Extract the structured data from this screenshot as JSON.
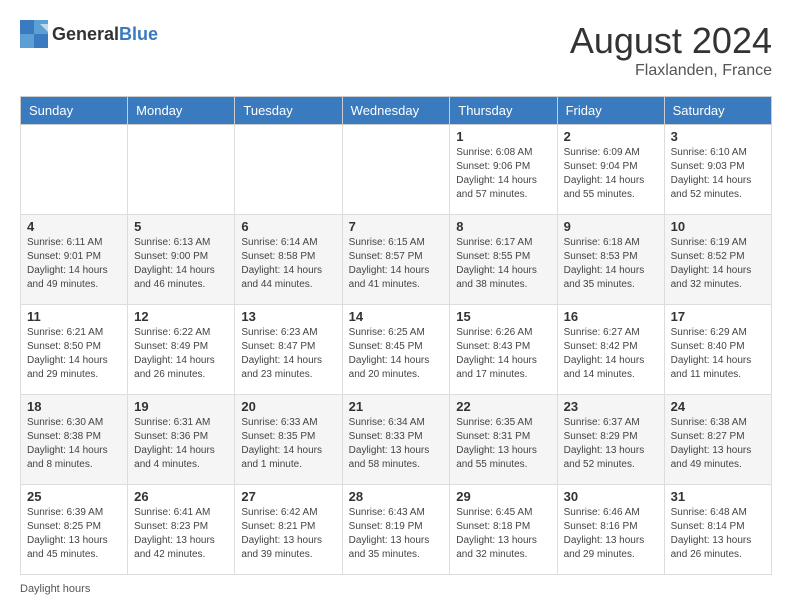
{
  "header": {
    "logo_general": "General",
    "logo_blue": "Blue",
    "month_year": "August 2024",
    "location": "Flaxlanden, France"
  },
  "weekdays": [
    "Sunday",
    "Monday",
    "Tuesday",
    "Wednesday",
    "Thursday",
    "Friday",
    "Saturday"
  ],
  "weeks": [
    [
      {
        "day": "",
        "info": ""
      },
      {
        "day": "",
        "info": ""
      },
      {
        "day": "",
        "info": ""
      },
      {
        "day": "",
        "info": ""
      },
      {
        "day": "1",
        "info": "Sunrise: 6:08 AM\nSunset: 9:06 PM\nDaylight: 14 hours and 57 minutes."
      },
      {
        "day": "2",
        "info": "Sunrise: 6:09 AM\nSunset: 9:04 PM\nDaylight: 14 hours and 55 minutes."
      },
      {
        "day": "3",
        "info": "Sunrise: 6:10 AM\nSunset: 9:03 PM\nDaylight: 14 hours and 52 minutes."
      }
    ],
    [
      {
        "day": "4",
        "info": "Sunrise: 6:11 AM\nSunset: 9:01 PM\nDaylight: 14 hours and 49 minutes."
      },
      {
        "day": "5",
        "info": "Sunrise: 6:13 AM\nSunset: 9:00 PM\nDaylight: 14 hours and 46 minutes."
      },
      {
        "day": "6",
        "info": "Sunrise: 6:14 AM\nSunset: 8:58 PM\nDaylight: 14 hours and 44 minutes."
      },
      {
        "day": "7",
        "info": "Sunrise: 6:15 AM\nSunset: 8:57 PM\nDaylight: 14 hours and 41 minutes."
      },
      {
        "day": "8",
        "info": "Sunrise: 6:17 AM\nSunset: 8:55 PM\nDaylight: 14 hours and 38 minutes."
      },
      {
        "day": "9",
        "info": "Sunrise: 6:18 AM\nSunset: 8:53 PM\nDaylight: 14 hours and 35 minutes."
      },
      {
        "day": "10",
        "info": "Sunrise: 6:19 AM\nSunset: 8:52 PM\nDaylight: 14 hours and 32 minutes."
      }
    ],
    [
      {
        "day": "11",
        "info": "Sunrise: 6:21 AM\nSunset: 8:50 PM\nDaylight: 14 hours and 29 minutes."
      },
      {
        "day": "12",
        "info": "Sunrise: 6:22 AM\nSunset: 8:49 PM\nDaylight: 14 hours and 26 minutes."
      },
      {
        "day": "13",
        "info": "Sunrise: 6:23 AM\nSunset: 8:47 PM\nDaylight: 14 hours and 23 minutes."
      },
      {
        "day": "14",
        "info": "Sunrise: 6:25 AM\nSunset: 8:45 PM\nDaylight: 14 hours and 20 minutes."
      },
      {
        "day": "15",
        "info": "Sunrise: 6:26 AM\nSunset: 8:43 PM\nDaylight: 14 hours and 17 minutes."
      },
      {
        "day": "16",
        "info": "Sunrise: 6:27 AM\nSunset: 8:42 PM\nDaylight: 14 hours and 14 minutes."
      },
      {
        "day": "17",
        "info": "Sunrise: 6:29 AM\nSunset: 8:40 PM\nDaylight: 14 hours and 11 minutes."
      }
    ],
    [
      {
        "day": "18",
        "info": "Sunrise: 6:30 AM\nSunset: 8:38 PM\nDaylight: 14 hours and 8 minutes."
      },
      {
        "day": "19",
        "info": "Sunrise: 6:31 AM\nSunset: 8:36 PM\nDaylight: 14 hours and 4 minutes."
      },
      {
        "day": "20",
        "info": "Sunrise: 6:33 AM\nSunset: 8:35 PM\nDaylight: 14 hours and 1 minute."
      },
      {
        "day": "21",
        "info": "Sunrise: 6:34 AM\nSunset: 8:33 PM\nDaylight: 13 hours and 58 minutes."
      },
      {
        "day": "22",
        "info": "Sunrise: 6:35 AM\nSunset: 8:31 PM\nDaylight: 13 hours and 55 minutes."
      },
      {
        "day": "23",
        "info": "Sunrise: 6:37 AM\nSunset: 8:29 PM\nDaylight: 13 hours and 52 minutes."
      },
      {
        "day": "24",
        "info": "Sunrise: 6:38 AM\nSunset: 8:27 PM\nDaylight: 13 hours and 49 minutes."
      }
    ],
    [
      {
        "day": "25",
        "info": "Sunrise: 6:39 AM\nSunset: 8:25 PM\nDaylight: 13 hours and 45 minutes."
      },
      {
        "day": "26",
        "info": "Sunrise: 6:41 AM\nSunset: 8:23 PM\nDaylight: 13 hours and 42 minutes."
      },
      {
        "day": "27",
        "info": "Sunrise: 6:42 AM\nSunset: 8:21 PM\nDaylight: 13 hours and 39 minutes."
      },
      {
        "day": "28",
        "info": "Sunrise: 6:43 AM\nSunset: 8:19 PM\nDaylight: 13 hours and 35 minutes."
      },
      {
        "day": "29",
        "info": "Sunrise: 6:45 AM\nSunset: 8:18 PM\nDaylight: 13 hours and 32 minutes."
      },
      {
        "day": "30",
        "info": "Sunrise: 6:46 AM\nSunset: 8:16 PM\nDaylight: 13 hours and 29 minutes."
      },
      {
        "day": "31",
        "info": "Sunrise: 6:48 AM\nSunset: 8:14 PM\nDaylight: 13 hours and 26 minutes."
      }
    ]
  ],
  "footer": {
    "note": "Daylight hours"
  }
}
